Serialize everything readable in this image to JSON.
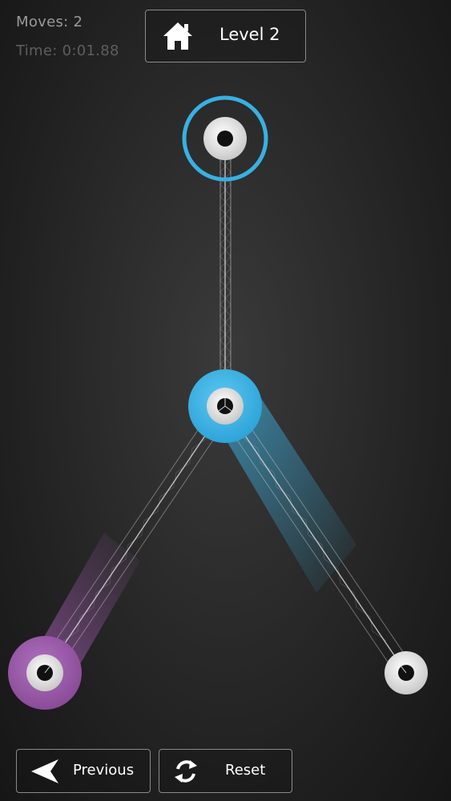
{
  "hud": {
    "moves_label": "Moves:",
    "moves_value": "2",
    "time_label": "Time:",
    "time_value": "0:01.88"
  },
  "header": {
    "level_label": "Level 2",
    "home_icon": "home-icon"
  },
  "footer": {
    "previous_label": "Previous",
    "previous_icon": "arrow-left-icon",
    "reset_label": "Reset",
    "reset_icon": "refresh-icon"
  },
  "colors": {
    "background": "#2b2b2b",
    "node_blue": "#3bb5e8",
    "node_purple": "#9a5ba8",
    "node_white": "#e6e6e6",
    "selection_ring": "#39b0e3",
    "link": "#cfcfcf"
  },
  "board": {
    "selected_node": "top-node",
    "nodes": [
      {
        "id": "top-node",
        "color": "white",
        "selected": true
      },
      {
        "id": "center-node",
        "color": "blue",
        "selected": false
      },
      {
        "id": "left-node",
        "color": "purple",
        "selected": false
      },
      {
        "id": "right-node",
        "color": "white",
        "selected": false
      }
    ],
    "links": [
      {
        "from": "top-node",
        "to": "center-node"
      },
      {
        "from": "center-node",
        "to": "left-node"
      },
      {
        "from": "center-node",
        "to": "right-node"
      }
    ]
  }
}
